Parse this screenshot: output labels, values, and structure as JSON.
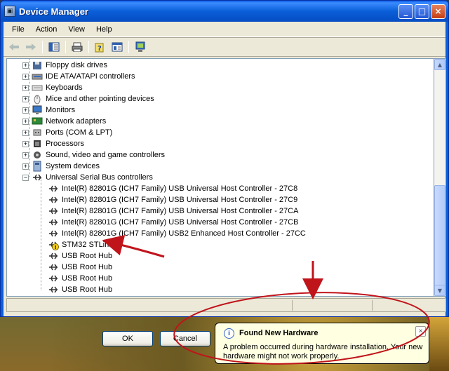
{
  "window": {
    "title": "Device Manager",
    "controls": {
      "minimize": "_",
      "maximize": "□",
      "close": "×"
    }
  },
  "menubar": {
    "items": [
      "File",
      "Action",
      "View",
      "Help"
    ]
  },
  "toolbar": {
    "icons": [
      "back-icon",
      "forward-icon",
      "show-hide-tree-icon",
      "print-icon",
      "help-icon",
      "properties-icon",
      "scan-hardware-icon"
    ]
  },
  "tree": {
    "categories": [
      {
        "label": "Floppy disk drives",
        "expander": "+"
      },
      {
        "label": "IDE ATA/ATAPI controllers",
        "expander": "+"
      },
      {
        "label": "Keyboards",
        "expander": "+"
      },
      {
        "label": "Mice and other pointing devices",
        "expander": "+"
      },
      {
        "label": "Monitors",
        "expander": "+"
      },
      {
        "label": "Network adapters",
        "expander": "+"
      },
      {
        "label": "Ports (COM & LPT)",
        "expander": "+"
      },
      {
        "label": "Processors",
        "expander": "+"
      },
      {
        "label": "Sound, video and game controllers",
        "expander": "+"
      },
      {
        "label": "System devices",
        "expander": "+"
      },
      {
        "label": "Universal Serial Bus controllers",
        "expander": "−"
      }
    ],
    "usb_devices": [
      "Intel(R) 82801G (ICH7 Family) USB Universal Host Controller - 27C8",
      "Intel(R) 82801G (ICH7 Family) USB Universal Host Controller - 27C9",
      "Intel(R) 82801G (ICH7 Family) USB Universal Host Controller - 27CA",
      "Intel(R) 82801G (ICH7 Family) USB Universal Host Controller - 27CB",
      "Intel(R) 82801G (ICH7 Family) USB2 Enhanced Host Controller - 27CC",
      "STM32 STLink",
      "USB Root Hub",
      "USB Root Hub",
      "USB Root Hub",
      "USB Root Hub"
    ]
  },
  "dialog_buttons": {
    "ok": "OK",
    "cancel": "Cancel"
  },
  "balloon": {
    "title": "Found New Hardware",
    "message": "A problem occurred during hardware installation. Your new hardware might not work properly.",
    "close": "×",
    "icon": "info-icon"
  },
  "colors": {
    "titlebar": "#0a5fd8",
    "annotation": "#c0141b",
    "balloon_bg": "#ffffe1"
  }
}
